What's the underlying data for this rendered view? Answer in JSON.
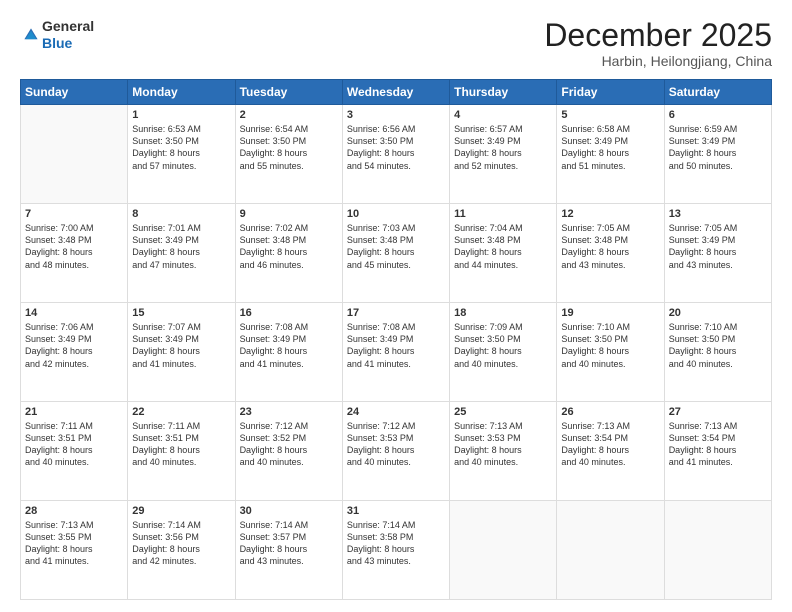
{
  "logo": {
    "line1": "General",
    "line2": "Blue"
  },
  "header": {
    "month": "December 2025",
    "location": "Harbin, Heilongjiang, China"
  },
  "days": [
    "Sunday",
    "Monday",
    "Tuesday",
    "Wednesday",
    "Thursday",
    "Friday",
    "Saturday"
  ],
  "weeks": [
    [
      {
        "num": "",
        "info": ""
      },
      {
        "num": "1",
        "info": "Sunrise: 6:53 AM\nSunset: 3:50 PM\nDaylight: 8 hours\nand 57 minutes."
      },
      {
        "num": "2",
        "info": "Sunrise: 6:54 AM\nSunset: 3:50 PM\nDaylight: 8 hours\nand 55 minutes."
      },
      {
        "num": "3",
        "info": "Sunrise: 6:56 AM\nSunset: 3:50 PM\nDaylight: 8 hours\nand 54 minutes."
      },
      {
        "num": "4",
        "info": "Sunrise: 6:57 AM\nSunset: 3:49 PM\nDaylight: 8 hours\nand 52 minutes."
      },
      {
        "num": "5",
        "info": "Sunrise: 6:58 AM\nSunset: 3:49 PM\nDaylight: 8 hours\nand 51 minutes."
      },
      {
        "num": "6",
        "info": "Sunrise: 6:59 AM\nSunset: 3:49 PM\nDaylight: 8 hours\nand 50 minutes."
      }
    ],
    [
      {
        "num": "7",
        "info": "Sunrise: 7:00 AM\nSunset: 3:48 PM\nDaylight: 8 hours\nand 48 minutes."
      },
      {
        "num": "8",
        "info": "Sunrise: 7:01 AM\nSunset: 3:49 PM\nDaylight: 8 hours\nand 47 minutes."
      },
      {
        "num": "9",
        "info": "Sunrise: 7:02 AM\nSunset: 3:48 PM\nDaylight: 8 hours\nand 46 minutes."
      },
      {
        "num": "10",
        "info": "Sunrise: 7:03 AM\nSunset: 3:48 PM\nDaylight: 8 hours\nand 45 minutes."
      },
      {
        "num": "11",
        "info": "Sunrise: 7:04 AM\nSunset: 3:48 PM\nDaylight: 8 hours\nand 44 minutes."
      },
      {
        "num": "12",
        "info": "Sunrise: 7:05 AM\nSunset: 3:48 PM\nDaylight: 8 hours\nand 43 minutes."
      },
      {
        "num": "13",
        "info": "Sunrise: 7:05 AM\nSunset: 3:49 PM\nDaylight: 8 hours\nand 43 minutes."
      }
    ],
    [
      {
        "num": "14",
        "info": "Sunrise: 7:06 AM\nSunset: 3:49 PM\nDaylight: 8 hours\nand 42 minutes."
      },
      {
        "num": "15",
        "info": "Sunrise: 7:07 AM\nSunset: 3:49 PM\nDaylight: 8 hours\nand 41 minutes."
      },
      {
        "num": "16",
        "info": "Sunrise: 7:08 AM\nSunset: 3:49 PM\nDaylight: 8 hours\nand 41 minutes."
      },
      {
        "num": "17",
        "info": "Sunrise: 7:08 AM\nSunset: 3:49 PM\nDaylight: 8 hours\nand 41 minutes."
      },
      {
        "num": "18",
        "info": "Sunrise: 7:09 AM\nSunset: 3:50 PM\nDaylight: 8 hours\nand 40 minutes."
      },
      {
        "num": "19",
        "info": "Sunrise: 7:10 AM\nSunset: 3:50 PM\nDaylight: 8 hours\nand 40 minutes."
      },
      {
        "num": "20",
        "info": "Sunrise: 7:10 AM\nSunset: 3:50 PM\nDaylight: 8 hours\nand 40 minutes."
      }
    ],
    [
      {
        "num": "21",
        "info": "Sunrise: 7:11 AM\nSunset: 3:51 PM\nDaylight: 8 hours\nand 40 minutes."
      },
      {
        "num": "22",
        "info": "Sunrise: 7:11 AM\nSunset: 3:51 PM\nDaylight: 8 hours\nand 40 minutes."
      },
      {
        "num": "23",
        "info": "Sunrise: 7:12 AM\nSunset: 3:52 PM\nDaylight: 8 hours\nand 40 minutes."
      },
      {
        "num": "24",
        "info": "Sunrise: 7:12 AM\nSunset: 3:53 PM\nDaylight: 8 hours\nand 40 minutes."
      },
      {
        "num": "25",
        "info": "Sunrise: 7:13 AM\nSunset: 3:53 PM\nDaylight: 8 hours\nand 40 minutes."
      },
      {
        "num": "26",
        "info": "Sunrise: 7:13 AM\nSunset: 3:54 PM\nDaylight: 8 hours\nand 40 minutes."
      },
      {
        "num": "27",
        "info": "Sunrise: 7:13 AM\nSunset: 3:54 PM\nDaylight: 8 hours\nand 41 minutes."
      }
    ],
    [
      {
        "num": "28",
        "info": "Sunrise: 7:13 AM\nSunset: 3:55 PM\nDaylight: 8 hours\nand 41 minutes."
      },
      {
        "num": "29",
        "info": "Sunrise: 7:14 AM\nSunset: 3:56 PM\nDaylight: 8 hours\nand 42 minutes."
      },
      {
        "num": "30",
        "info": "Sunrise: 7:14 AM\nSunset: 3:57 PM\nDaylight: 8 hours\nand 43 minutes."
      },
      {
        "num": "31",
        "info": "Sunrise: 7:14 AM\nSunset: 3:58 PM\nDaylight: 8 hours\nand 43 minutes."
      },
      {
        "num": "",
        "info": ""
      },
      {
        "num": "",
        "info": ""
      },
      {
        "num": "",
        "info": ""
      }
    ]
  ]
}
